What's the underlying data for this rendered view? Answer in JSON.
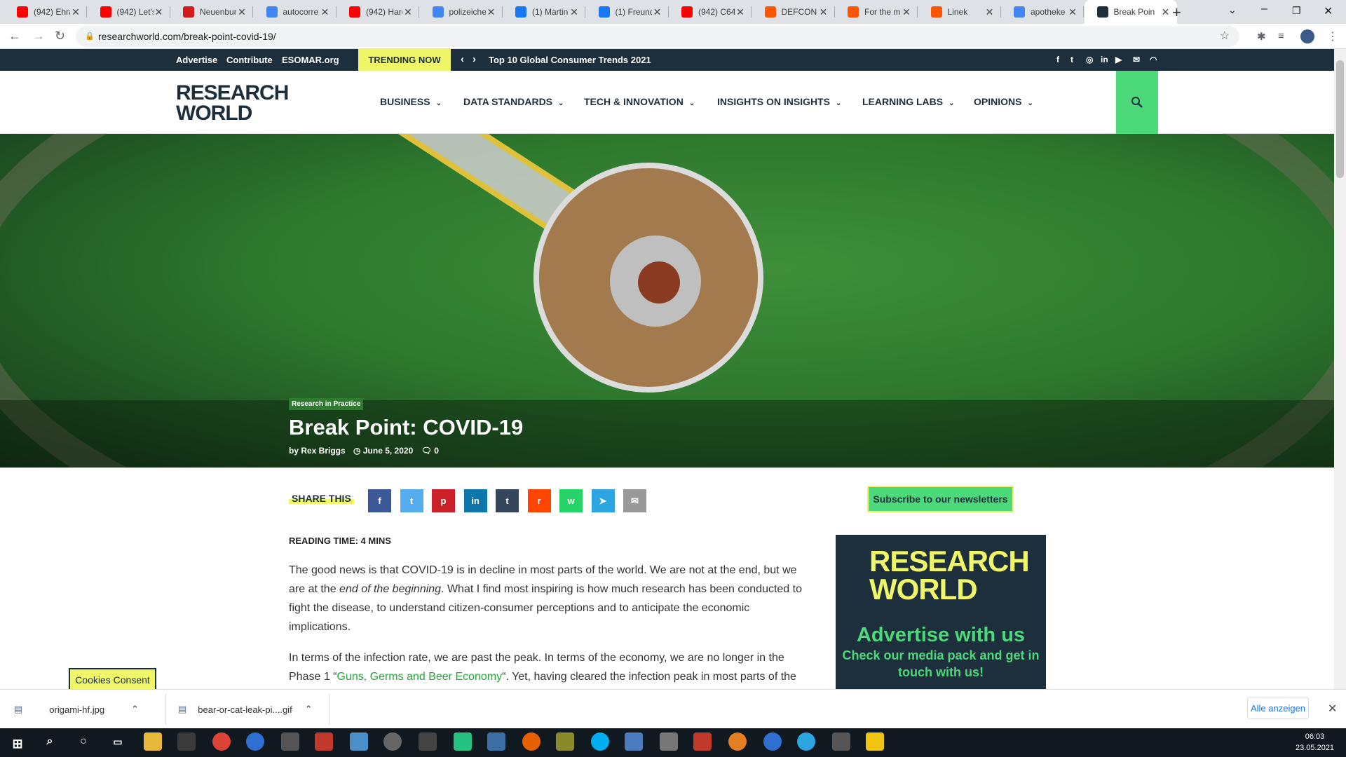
{
  "browser": {
    "tabs": [
      {
        "title": "(942) Ehra",
        "icon": "youtube-icon",
        "color": "#ff0000"
      },
      {
        "title": "(942) Let's",
        "icon": "youtube-icon",
        "color": "#ff0000"
      },
      {
        "title": "Neuenbur",
        "icon": "zeit-icon",
        "color": "#d21a1a"
      },
      {
        "title": "autocorre",
        "icon": "google-icon",
        "color": "#4285f4"
      },
      {
        "title": "(942) Harc",
        "icon": "youtube-icon",
        "color": "#ff0000"
      },
      {
        "title": "polizeiche",
        "icon": "google-icon",
        "color": "#4285f4"
      },
      {
        "title": "(1) Martin",
        "icon": "facebook-icon",
        "color": "#1877f2"
      },
      {
        "title": "(1) Freund",
        "icon": "facebook-icon",
        "color": "#1877f2"
      },
      {
        "title": "(942) C64",
        "icon": "youtube-icon",
        "color": "#ff0000"
      },
      {
        "title": "DEFCON 5",
        "icon": "soundcloud-icon",
        "color": "#ff5500"
      },
      {
        "title": "For the m",
        "icon": "soundcloud-icon",
        "color": "#ff5500"
      },
      {
        "title": "Linek",
        "icon": "soundcloud-icon",
        "color": "#ff5500"
      },
      {
        "title": "apotheke",
        "icon": "google-icon",
        "color": "#4285f4"
      },
      {
        "title": "Break Poin",
        "icon": "rw-icon",
        "color": "#1d2f3c",
        "active": true
      }
    ],
    "url": "researchworld.com/break-point-covid-19/"
  },
  "site": {
    "topbar": {
      "links": [
        "Advertise",
        "Contribute",
        "ESOMAR.org"
      ],
      "trending_label": "TRENDING NOW",
      "trending_headline": "Top 10 Global Consumer Trends 2021"
    },
    "logo_line1": "RESEARCH",
    "logo_line2": "WORLD",
    "menu": [
      "BUSINESS",
      "DATA STANDARDS",
      "TECH & INNOVATION",
      "INSIGHTS ON INSIGHTS",
      "LEARNING LABS",
      "OPINIONS"
    ]
  },
  "article": {
    "category": "Research in Practice",
    "title": "Break Point: COVID-19",
    "author": "by Rex Briggs",
    "date": "June 5, 2020",
    "comments": "0",
    "share_label": "SHARE THIS",
    "share_buttons": [
      {
        "name": "facebook",
        "color": "#3b5998",
        "glyph": "f"
      },
      {
        "name": "twitter",
        "color": "#55acee",
        "glyph": "t"
      },
      {
        "name": "pinterest",
        "color": "#cb2027",
        "glyph": "p"
      },
      {
        "name": "linkedin",
        "color": "#0e76a8",
        "glyph": "in"
      },
      {
        "name": "tumblr",
        "color": "#35465c",
        "glyph": "t"
      },
      {
        "name": "reddit",
        "color": "#ff4500",
        "glyph": "r"
      },
      {
        "name": "whatsapp",
        "color": "#25d366",
        "glyph": "w"
      },
      {
        "name": "telegram",
        "color": "#2ca5e0",
        "glyph": "➤"
      },
      {
        "name": "email",
        "color": "#999999",
        "glyph": "✉"
      }
    ],
    "reading_time": "READING TIME: 4 MINS",
    "para1_a": "The good news is that COVID-19 is in decline in most parts of the world. We are not at the end, but we are at the ",
    "para1_em": "end of the beginning",
    "para1_b": ". What I find most inspiring is how much research has been conducted to fight the disease, to understand citizen-consumer perceptions and to anticipate the economic implications.",
    "para2_a": "In terms of the infection rate, we are past the peak. In terms of the economy, we are no longer in the Phase 1 “",
    "para2_link": "Guns, Germs and Beer Economy",
    "para2_b": "“. Yet, having cleared the infection peak in most parts of the"
  },
  "sidebar": {
    "subscribe": "Subscribe to our newsletters",
    "ad_logo_line1": "RESEARCH",
    "ad_logo_line2": "WORLD",
    "ad_title": "Advertise with us",
    "ad_sub": "Check our media pack and get in touch with us!"
  },
  "cookies": "Cookies Consent",
  "downloads": {
    "items": [
      "origami-hf.jpg",
      "bear-or-cat-leak-pi....gif"
    ],
    "show_all": "Alle anzeigen"
  },
  "taskbar": {
    "time": "06:03",
    "date": "23.05.2021"
  }
}
